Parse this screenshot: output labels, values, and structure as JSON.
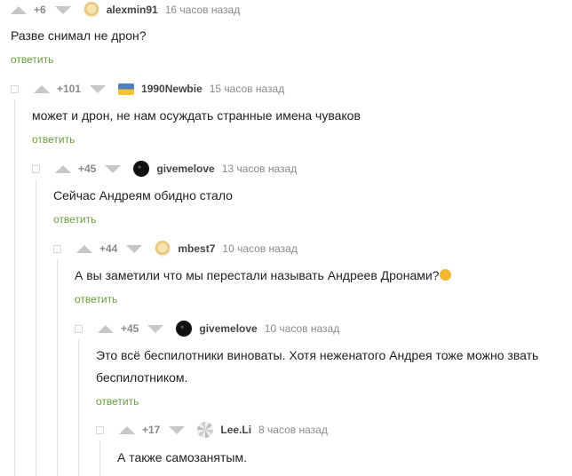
{
  "comments": [
    {
      "rating": "+6",
      "user": "alexmin91",
      "time": "16 часов назад",
      "text": "Разве снимал не дрон?",
      "reply": "ответить"
    },
    {
      "rating": "+101",
      "user": "1990Newbie",
      "time": "15 часов назад",
      "text": "может и дрон, не нам осуждать странные имена чуваков",
      "reply": "ответить"
    },
    {
      "rating": "+45",
      "user": "givemelove",
      "time": "13 часов назад",
      "text": "Сейчас Андреям обидно стало",
      "reply": "ответить"
    },
    {
      "rating": "+44",
      "user": "mbest7",
      "time": "10 часов назад",
      "text": "А вы заметили что мы перестали называть Андреев Дронами?",
      "emoji": "🤔",
      "reply": "ответить"
    },
    {
      "rating": "+45",
      "user": "givemelove",
      "time": "10 часов назад",
      "text_line1": "Это всё беспилотники виноваты. Хотя неженатого Андрея тоже можно звать",
      "text_line2": "беспилотником.",
      "reply": "ответить"
    },
    {
      "rating": "+17",
      "user": "Lee.Li",
      "time": "8 часов назад",
      "text": "А также самозанятым."
    }
  ],
  "icons": {
    "upvote": "arrow-up-icon",
    "downvote": "arrow-down-icon",
    "collapse": "collapse-square-icon"
  },
  "colors": {
    "reply_link": "#6b9e3e",
    "vote_arrow": "#c7c7c7",
    "thread_line": "#e3e3e3"
  }
}
